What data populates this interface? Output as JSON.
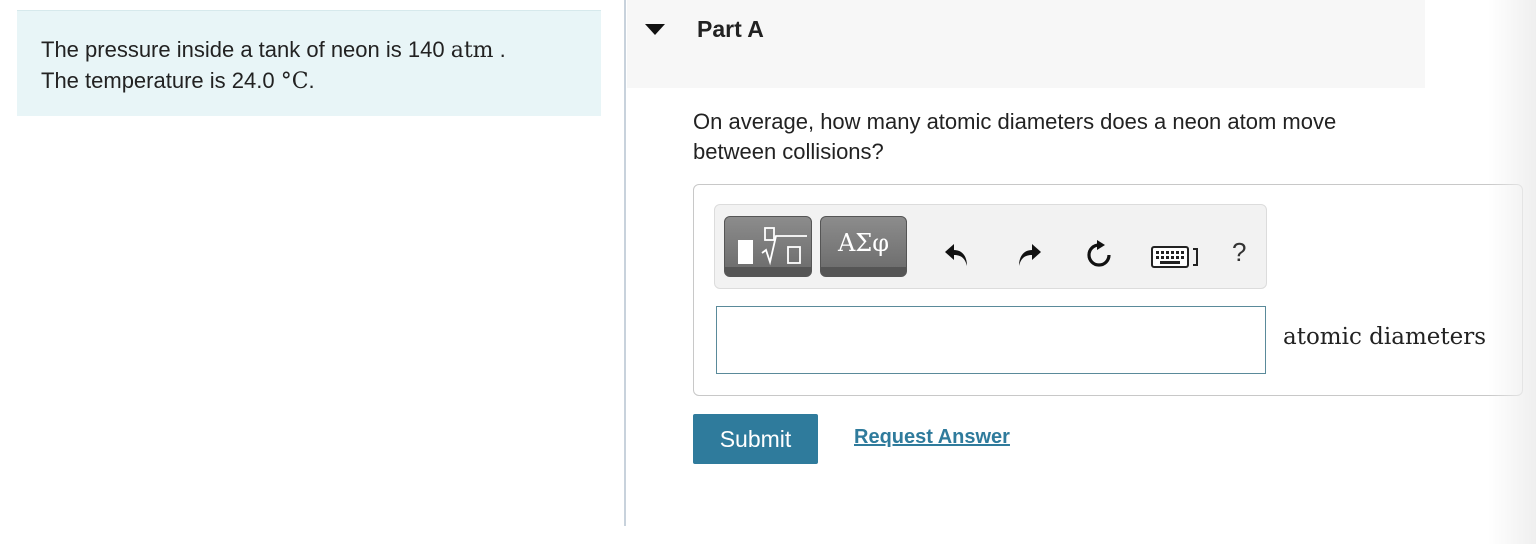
{
  "problem": {
    "line1_text": "The pressure inside a tank of neon is 140 ",
    "line1_unit": "atm",
    "line1_end": " .",
    "line2_text": "The temperature is 24.0 ",
    "line2_unit": "°C",
    "line2_end": "."
  },
  "part": {
    "title": "Part A",
    "question": "On average, how many atomic diameters does a neon atom move between collisions?"
  },
  "toolbar": {
    "symbols_label": "ΑΣφ",
    "help_label": "?"
  },
  "answer": {
    "value": "",
    "units": "atomic diameters"
  },
  "actions": {
    "submit_label": "Submit",
    "request_label": "Request Answer"
  },
  "colors": {
    "accent": "#2f7b9c",
    "problem_bg": "#e8f5f7"
  }
}
